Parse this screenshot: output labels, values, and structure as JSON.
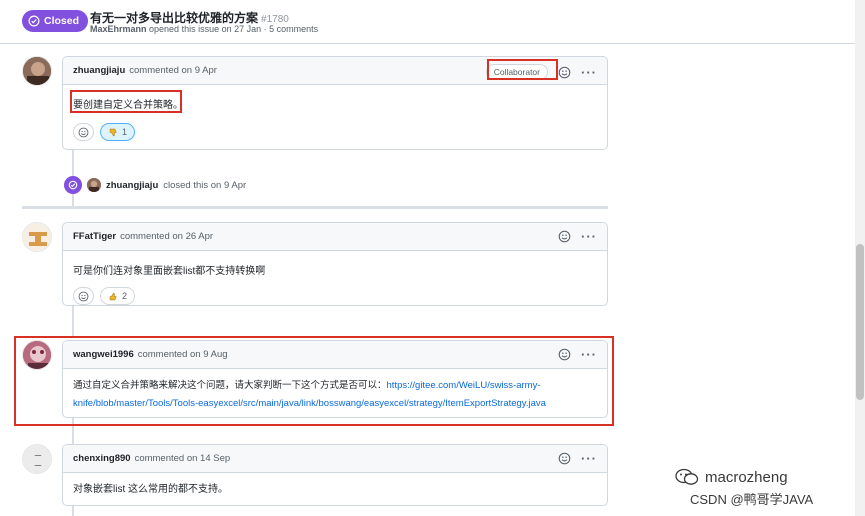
{
  "header": {
    "status": "Closed",
    "title": "有无一对多导出比较优雅的方案",
    "number": "#1780",
    "meta_author": "MaxEhrmann",
    "meta_text": "opened this issue on 27 Jan · 5 comments"
  },
  "comments": [
    {
      "author": "zhuangjiaju",
      "meta": "commented on 9 Apr",
      "badge": "Collaborator",
      "body": "要创建自定义合并策略。",
      "reactions": [
        {
          "icon": "thumbs-down-icon",
          "count": "1"
        }
      ]
    },
    {
      "author": "FFatTiger",
      "meta": "commented on 26 Apr",
      "body": "可是你们连对象里面嵌套list都不支持转换啊",
      "reactions": [
        {
          "icon": "thumbs-up-icon",
          "count": "2"
        }
      ]
    },
    {
      "author": "wangwei1996",
      "meta": "commented on 9 Aug",
      "body_text": "通过自定义合并策略来解决这个问题，请大家判断一下这个方式是否可以：",
      "link_line1": "https://gitee.com/WeiLU/swiss-army-",
      "link_line2": "knife/blob/master/Tools/Tools-easyexcel/src/main/java/link/bosswang/easyexcel/strategy/ItemExportStrategy.java"
    },
    {
      "author": "chenxing890",
      "meta": "commented on 14 Sep",
      "body": "对象嵌套list 这么常用的都不支持。"
    }
  ],
  "event": {
    "author": "zhuangjiaju",
    "text": "closed this on 9 Apr"
  },
  "watermark": {
    "line1": "macrozheng",
    "line2": "CSDN @鸭哥学JAVA"
  },
  "colors": {
    "closed_purple": "#8250df",
    "highlight_red": "#d93025",
    "link_blue": "#0969da"
  }
}
